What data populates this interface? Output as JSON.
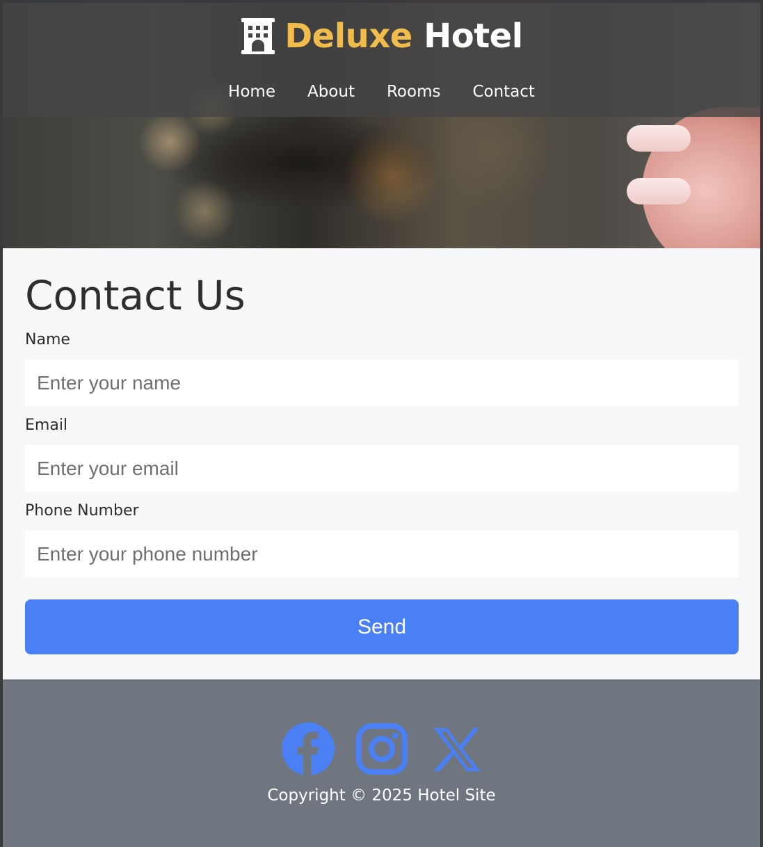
{
  "brand": {
    "icon": "hotel-building-icon",
    "name_first": "Deluxe",
    "name_second": "Hotel"
  },
  "nav": {
    "items": [
      "Home",
      "About",
      "Rooms",
      "Contact"
    ]
  },
  "contact": {
    "title": "Contact Us",
    "fields": [
      {
        "label": "Name",
        "placeholder": "Enter your name",
        "value": ""
      },
      {
        "label": "Email",
        "placeholder": "Enter your email",
        "value": ""
      },
      {
        "label": "Phone Number",
        "placeholder": "Enter your phone number",
        "value": ""
      }
    ],
    "submit_label": "Send"
  },
  "footer": {
    "social_icons": [
      "facebook-icon",
      "instagram-icon",
      "x-icon"
    ],
    "copyright": "Copyright © 2025 Hotel Site"
  },
  "colors": {
    "brand_accent": "#f0bd4c",
    "primary_button": "#4a80f4",
    "social_icon": "#4a80f4",
    "footer_bg": "#6f7680",
    "page_bg": "#f7f8fa"
  }
}
